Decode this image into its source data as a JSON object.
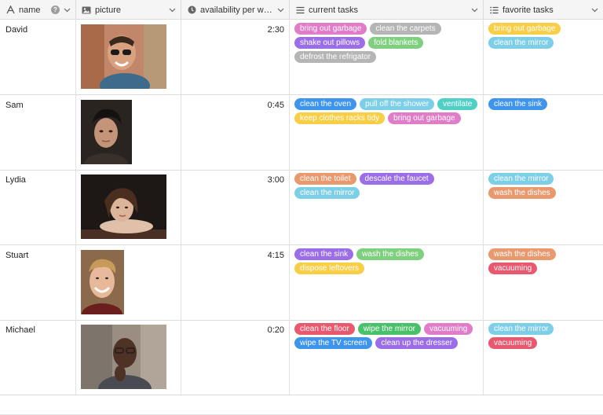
{
  "columns": [
    {
      "key": "name",
      "label": "name",
      "icon": "text-field-icon"
    },
    {
      "key": "picture",
      "label": "picture",
      "icon": "image-icon"
    },
    {
      "key": "availability",
      "label": "availability per we...",
      "icon": "clock-icon"
    },
    {
      "key": "current_tasks",
      "label": "current tasks",
      "icon": "list-icon"
    },
    {
      "key": "favorite_tasks",
      "label": "favorite tasks",
      "icon": "list-icon"
    }
  ],
  "help_glyph": "?",
  "colors": {
    "pink": "#e07cc8",
    "gray": "#b5b5b5",
    "purple": "#9b6ee8",
    "green": "#7ed07e",
    "blue": "#3f95ee",
    "lightblue": "#7dcfe8",
    "teal": "#4fcfc6",
    "yellow": "#f7ce46",
    "orange": "#e89a6e",
    "red": "#e8586e",
    "darkgreen": "#48c16a"
  },
  "rows": [
    {
      "name": "David",
      "availability": "2:30",
      "current_tasks": [
        {
          "label": "bring out garbage",
          "color": "pink"
        },
        {
          "label": "clean the carpets",
          "color": "gray"
        },
        {
          "label": "shake out pillows",
          "color": "purple"
        },
        {
          "label": "fold blankets",
          "color": "green"
        },
        {
          "label": "defrost the refrigator",
          "color": "gray"
        }
      ],
      "favorite_tasks": [
        {
          "label": "bring out garbage",
          "color": "yellow"
        },
        {
          "label": "clean the mirror",
          "color": "lightblue"
        }
      ]
    },
    {
      "name": "Sam",
      "availability": "0:45",
      "current_tasks": [
        {
          "label": "clean the oven",
          "color": "blue"
        },
        {
          "label": "pull off the shower",
          "color": "lightblue"
        },
        {
          "label": "ventilate",
          "color": "teal"
        },
        {
          "label": "keep clothes racks tidy",
          "color": "yellow"
        },
        {
          "label": "bring out garbage",
          "color": "pink"
        }
      ],
      "favorite_tasks": [
        {
          "label": "clean the sink",
          "color": "blue"
        }
      ]
    },
    {
      "name": "Lydia",
      "availability": "3:00",
      "current_tasks": [
        {
          "label": "clean the toilet",
          "color": "orange"
        },
        {
          "label": "descale the faucet",
          "color": "purple"
        },
        {
          "label": "clean the mirror",
          "color": "lightblue"
        }
      ],
      "favorite_tasks": [
        {
          "label": "clean the mirror",
          "color": "lightblue"
        },
        {
          "label": "wash the dishes",
          "color": "orange"
        }
      ]
    },
    {
      "name": "Stuart",
      "availability": "4:15",
      "current_tasks": [
        {
          "label": "clean the sink",
          "color": "purple"
        },
        {
          "label": "wash the dishes",
          "color": "green"
        },
        {
          "label": "dispose leftovers",
          "color": "yellow"
        }
      ],
      "favorite_tasks": [
        {
          "label": "wash the dishes",
          "color": "orange"
        },
        {
          "label": "vacuuming",
          "color": "red"
        }
      ]
    },
    {
      "name": "Michael",
      "availability": "0:20",
      "current_tasks": [
        {
          "label": "clean the floor",
          "color": "red"
        },
        {
          "label": "wipe the mirror",
          "color": "darkgreen"
        },
        {
          "label": "vacuuming",
          "color": "pink"
        },
        {
          "label": "wipe the TV screen",
          "color": "blue"
        },
        {
          "label": "clean up the dresser",
          "color": "purple"
        }
      ],
      "favorite_tasks": [
        {
          "label": "clean the mirror",
          "color": "lightblue"
        },
        {
          "label": "vacuuming",
          "color": "red"
        }
      ]
    }
  ]
}
